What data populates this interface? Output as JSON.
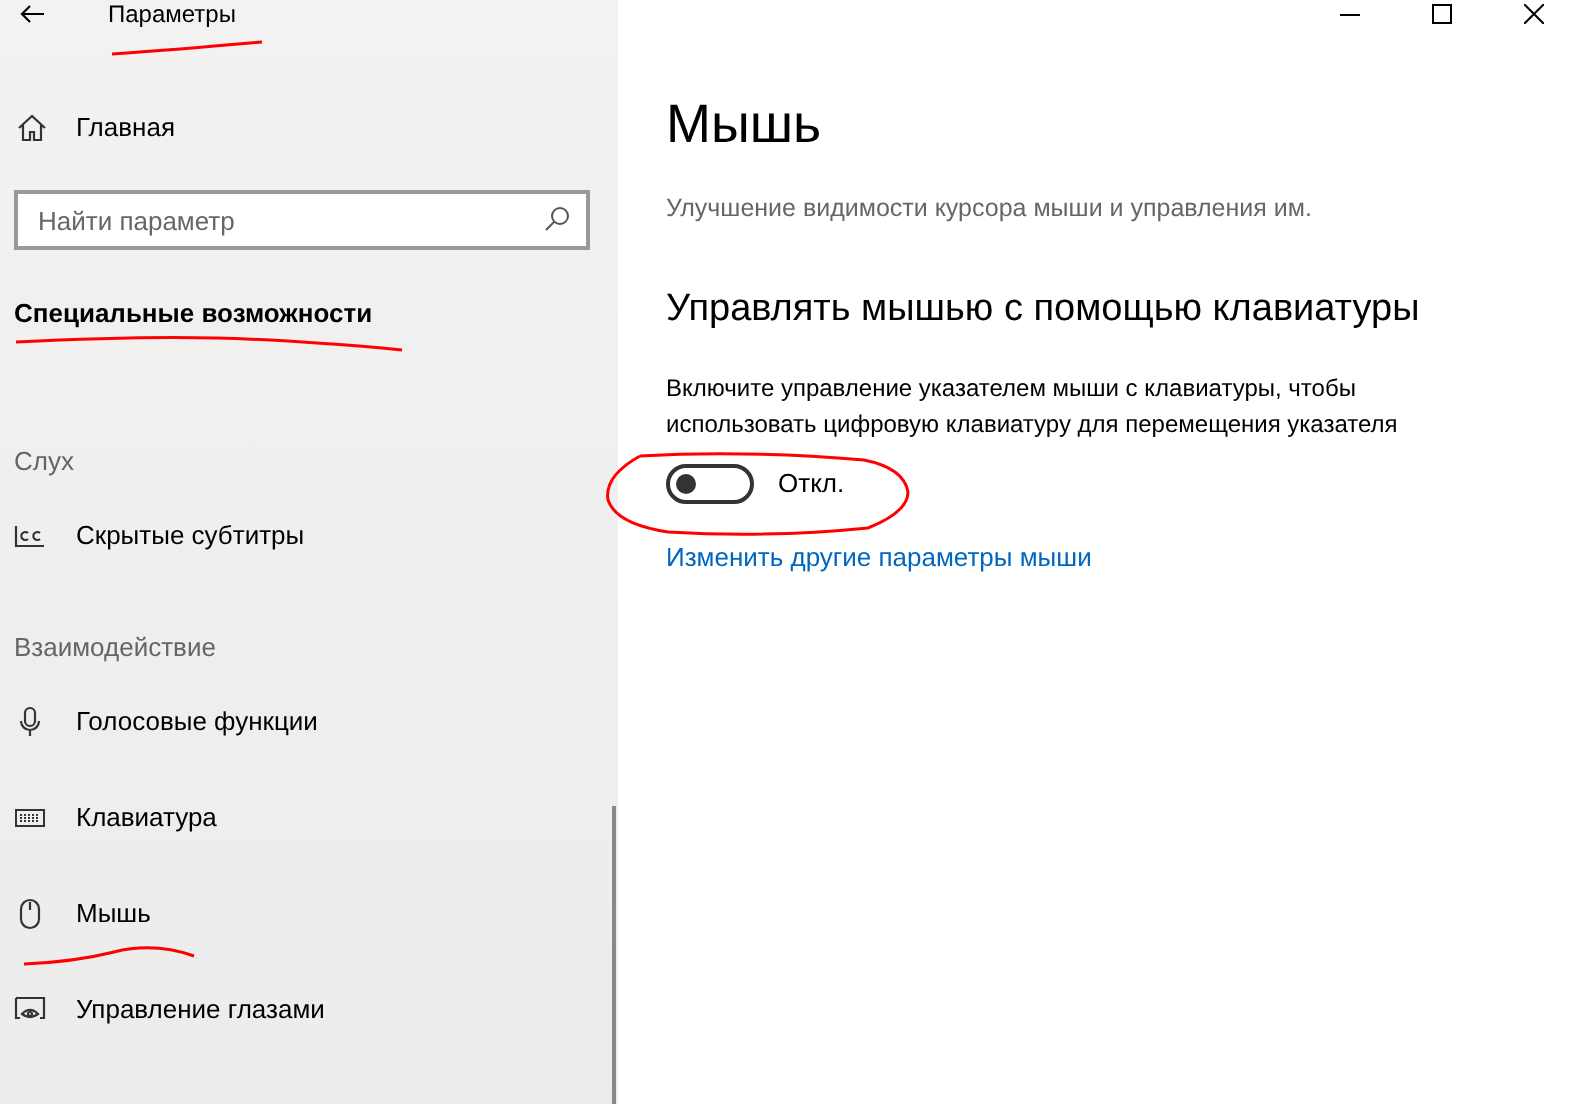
{
  "window": {
    "title": "Параметры"
  },
  "sidebar": {
    "home": "Главная",
    "search": {
      "placeholder": "Найти параметр"
    },
    "section_title": "Специальные возможности",
    "groups": [
      {
        "title": "Слух",
        "items": [
          {
            "label": "Скрытые субтитры",
            "kind": "captions"
          }
        ]
      },
      {
        "title": "Взаимодействие",
        "items": [
          {
            "label": "Голосовые функции",
            "kind": "microphone"
          },
          {
            "label": "Клавиатура",
            "kind": "keyboard"
          },
          {
            "label": "Мышь",
            "kind": "mouse"
          },
          {
            "label": "Управление глазами",
            "kind": "eye"
          }
        ]
      }
    ]
  },
  "content": {
    "title": "Мышь",
    "subtitle": "Улучшение видимости курсора мыши и управления им.",
    "section_title": "Управлять мышью с помощью клавиатуры",
    "description": "Включите управление указателем мыши с клавиатуры, чтобы использовать цифровую клавиатуру для перемещения указателя",
    "toggle": {
      "on": false,
      "label": "Откл."
    },
    "link": "Изменить другие параметры мыши"
  }
}
